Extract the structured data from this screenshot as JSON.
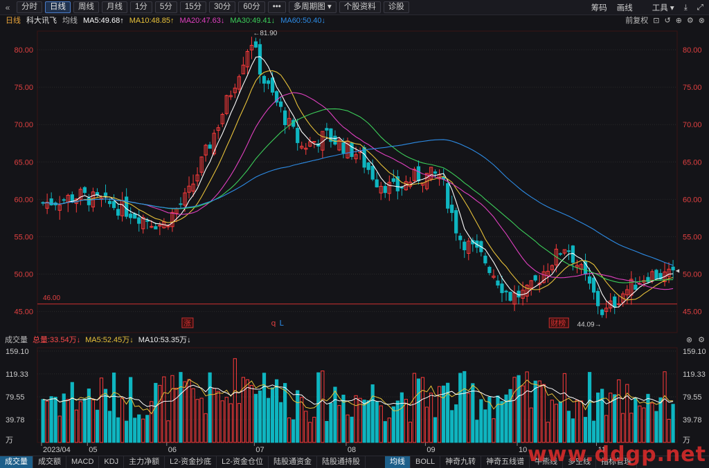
{
  "toolbar": {
    "back_icon": "chevron-left-icon",
    "periods": [
      "分时",
      "日线",
      "周线",
      "月线",
      "1分",
      "5分",
      "15分",
      "30分",
      "60分"
    ],
    "active_period": "日线",
    "more": "•••",
    "multi_period": "多周期图",
    "profile": "个股资料",
    "diagnose": "诊股",
    "right": {
      "chips": "筹码",
      "draw": "画线",
      "tools": "工具"
    }
  },
  "info": {
    "period": "日线",
    "name": "科大讯飞",
    "avg": "均线",
    "ma5": "MA5:49.68↑",
    "ma10": "MA10:48.85↑",
    "ma20": "MA20:47.63↓",
    "ma30": "MA30:49.41↓",
    "ma60": "MA60:50.40↓",
    "adjust": "前复权"
  },
  "volume_info": {
    "title": "成交量",
    "total": "总量:33.54万↓",
    "ma5": "MA5:52.45万↓",
    "ma10": "MA10:53.35万↓"
  },
  "chart_data": [
    {
      "type": "candlestick",
      "title": "科大讯飞 日线",
      "y_ticks": [
        "80.00",
        "75.00",
        "70.00",
        "65.00",
        "60.00",
        "55.00",
        "50.00",
        "45.00"
      ],
      "ylim": [
        44.5,
        82.5
      ],
      "x_labels": [
        "2023/04",
        "05",
        "06",
        "07",
        "08",
        "09",
        "10",
        "11"
      ],
      "high_label": "81.90",
      "low_label": "44.09→",
      "support_line": 46.0,
      "support_label": "46.00",
      "markers": [
        "涨",
        "q",
        "L",
        "财榜"
      ],
      "colors": {
        "up": "#ff3b3b",
        "down": "#0fb5c0",
        "ma5": "#ffffff",
        "ma10": "#e8c23a",
        "ma20": "#e040c0",
        "ma30": "#3ccf5a",
        "ma60": "#2d8ce6"
      },
      "key_points": [
        {
          "date": "2023/04",
          "close": 59.5
        },
        {
          "date": "05",
          "close": 60.0
        },
        {
          "date": "06",
          "close": 60.5
        },
        {
          "date": "06-late",
          "close": 77.0
        },
        {
          "date": "peak",
          "close": 81.9
        },
        {
          "date": "07",
          "close": 67.5
        },
        {
          "date": "08",
          "close": 61.0
        },
        {
          "date": "09",
          "close": 55.0
        },
        {
          "date": "10",
          "close": 47.0
        },
        {
          "date": "10-mid",
          "close": 54.5
        },
        {
          "date": "11",
          "close": 44.1
        },
        {
          "date": "now",
          "close": 49.7
        }
      ]
    },
    {
      "type": "bar",
      "title": "成交量",
      "y_ticks": [
        "159.10",
        "119.33",
        "79.55",
        "39.78",
        "万"
      ],
      "ylim": [
        0,
        165
      ],
      "unit": "万"
    }
  ],
  "bottom_tabs": {
    "left": [
      "成交量",
      "成交额",
      "MACD",
      "KDJ",
      "主力净额",
      "L2-资金抄底",
      "L2-资金仓位",
      "陆股通资金",
      "陆股通持股"
    ],
    "right": [
      "均线",
      "BOLL",
      "神奇九转",
      "神奇五线谱",
      "牛熊线",
      "多空线",
      "指标管理"
    ]
  },
  "watermark": "www.ddgp.net"
}
